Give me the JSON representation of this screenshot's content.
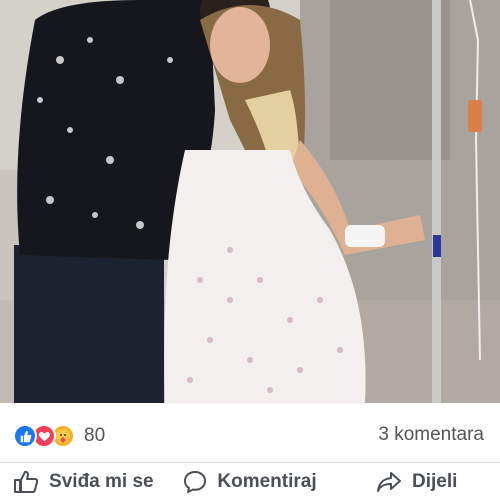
{
  "post": {
    "photo": {
      "alt": ""
    },
    "stats": {
      "reactions": [
        "like-icon",
        "love-icon",
        "care-icon"
      ],
      "reaction_count": "80",
      "comment_count": "3 komentara"
    },
    "actions": {
      "like_label": "Sviđa mi se",
      "comment_label": "Komentiraj",
      "share_label": "Dijeli"
    },
    "colors": {
      "like": "#1877f2",
      "love": "#f33e58",
      "care": "#f7b125",
      "action_text": "#4b4f56",
      "meta_text": "#555555"
    }
  }
}
